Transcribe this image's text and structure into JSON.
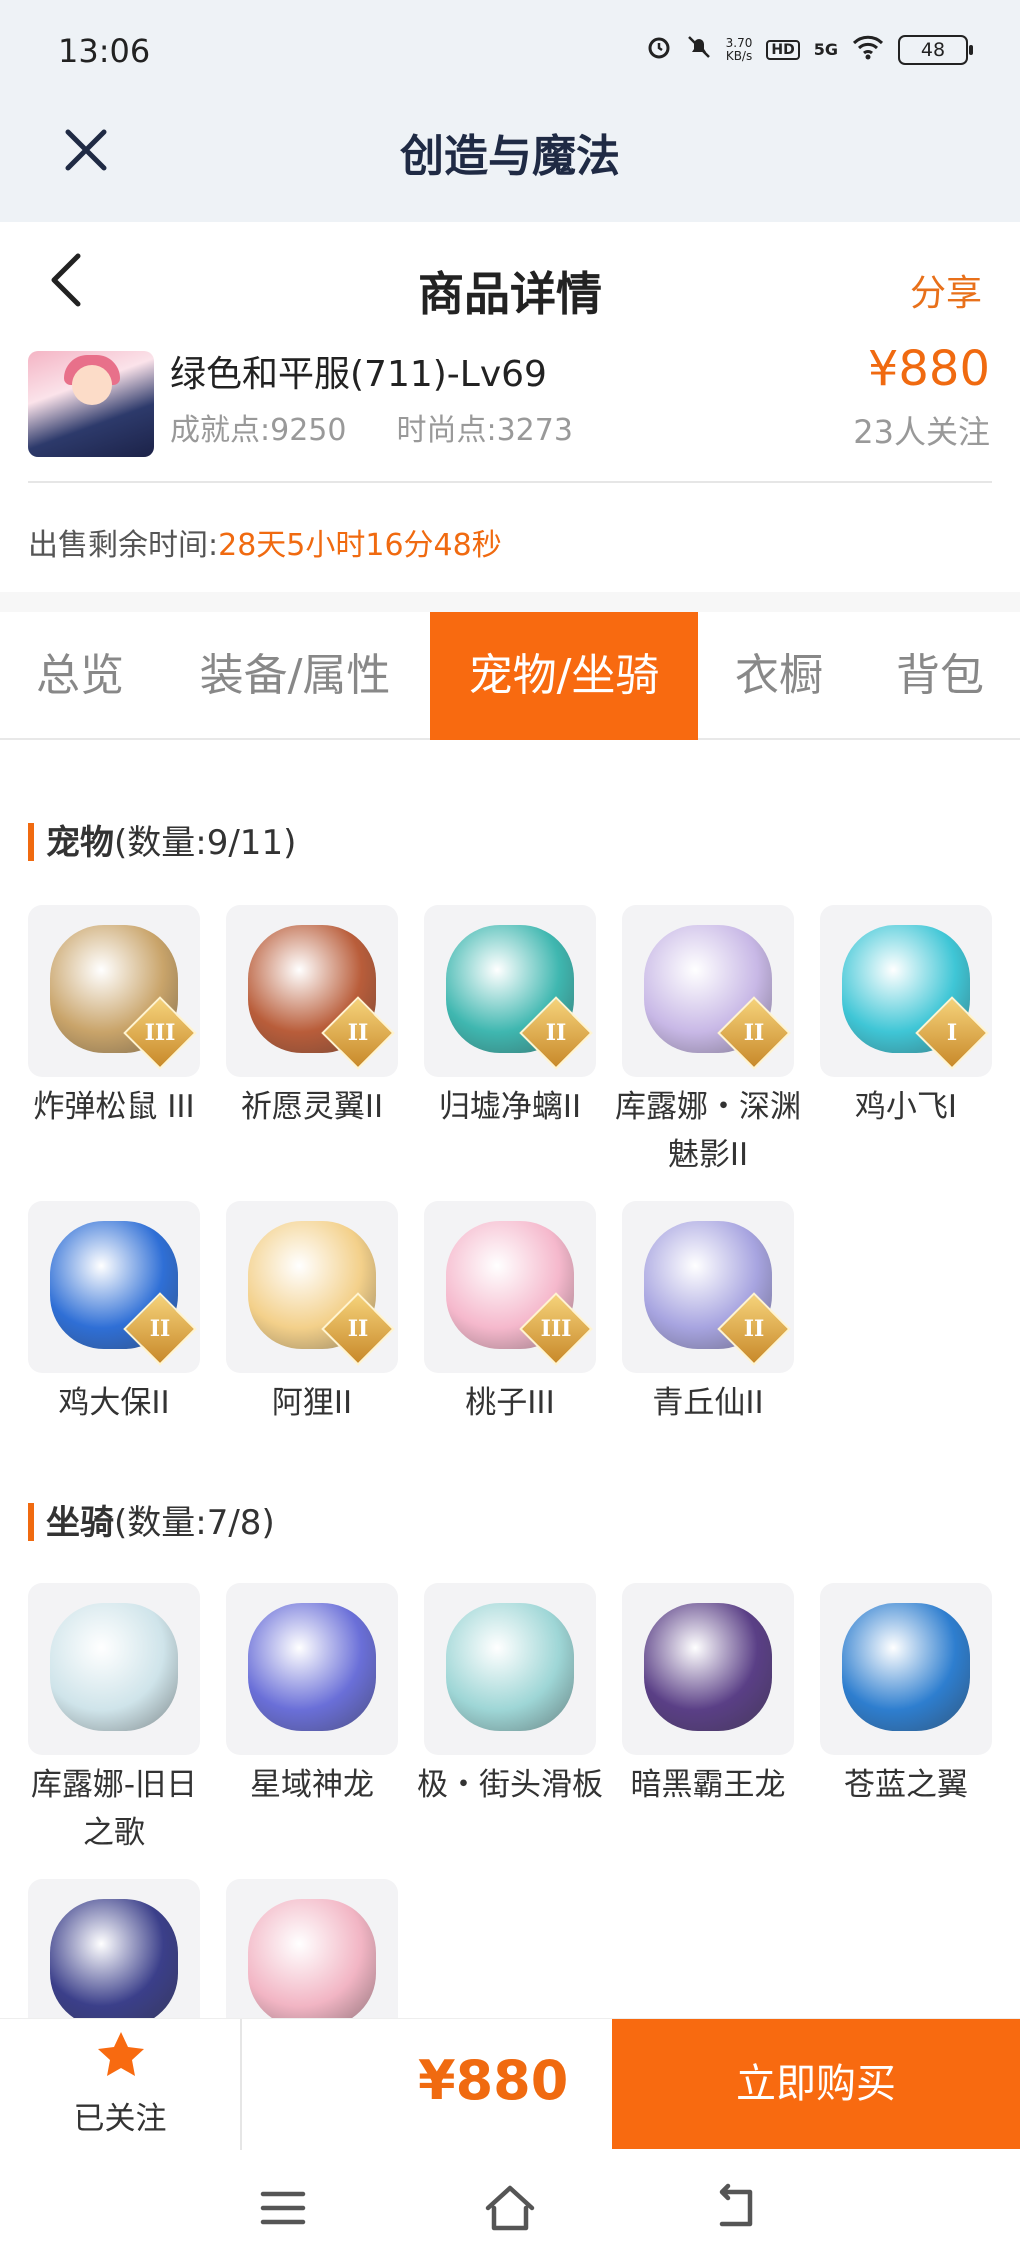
{
  "status_bar": {
    "time": "13:06",
    "net_speed_value": "3.70",
    "net_speed_unit": "KB/s",
    "hd_badge": "HD",
    "signal_label": "5G",
    "battery": "48",
    "icons": [
      "alarm-icon",
      "mute-icon",
      "wifi-icon",
      "battery-icon"
    ]
  },
  "app_bar": {
    "title": "创造与魔法",
    "close_icon": "close-icon"
  },
  "header": {
    "title": "商品详情",
    "share_label": "分享",
    "back_icon": "chevron-left-icon"
  },
  "product": {
    "name": "绿色和平服(711)-Lv69",
    "achievement": "成就点:9250",
    "fashion": "时尚点:3273",
    "price": "¥880",
    "followers": "23人关注"
  },
  "sale": {
    "label": "出售剩余时间:",
    "remaining": "28天5小时16分48秒"
  },
  "tabs": [
    {
      "label": "总览",
      "active": false
    },
    {
      "label": "装备/属性",
      "active": false
    },
    {
      "label": "宠物/坐骑",
      "active": true
    },
    {
      "label": "衣橱",
      "active": false
    },
    {
      "label": "背包",
      "active": false
    }
  ],
  "pets": {
    "title": "宠物",
    "count": "(数量:9/11)",
    "items": [
      {
        "name": "炸弹松鼠 III",
        "grade": "III",
        "color": "#c9a46a"
      },
      {
        "name": "祈愿灵翼II",
        "grade": "II",
        "color": "#b95d3a"
      },
      {
        "name": "归墟净螭II",
        "grade": "II",
        "color": "#3fb7b0"
      },
      {
        "name": "库露娜・深渊魅影II",
        "grade": "II",
        "color": "#c8b8e6"
      },
      {
        "name": "鸡小飞I",
        "grade": "I",
        "color": "#3fc6d6"
      },
      {
        "name": "鸡大保II",
        "grade": "II",
        "color": "#2f6fd6"
      },
      {
        "name": "阿狸II",
        "grade": "II",
        "color": "#f3d08a"
      },
      {
        "name": "桃子III",
        "grade": "III",
        "color": "#f5b8cc"
      },
      {
        "name": "青丘仙II",
        "grade": "II",
        "color": "#a7a4e0"
      }
    ]
  },
  "mounts": {
    "title": "坐骑",
    "count": "(数量:7/8)",
    "items": [
      {
        "name": "库露娜-旧日之歌",
        "color": "#cfe4ea"
      },
      {
        "name": "星域神龙",
        "color": "#6a6fd8"
      },
      {
        "name": "极・街头滑板",
        "color": "#9ed6d6"
      },
      {
        "name": "暗黑霸王龙",
        "color": "#5a3f86"
      },
      {
        "name": "苍蓝之翼",
        "color": "#2e7ecf"
      },
      {
        "name": "",
        "color": "#3b3f8a"
      },
      {
        "name": "",
        "color": "#f2b5c4"
      }
    ]
  },
  "bottom_bar": {
    "follow_label": "已关注",
    "price": "¥880",
    "buy_label": "立即购买"
  },
  "nav": {
    "icons": [
      "menu-icon",
      "home-icon",
      "back-icon"
    ]
  },
  "colors": {
    "accent": "#f86a10",
    "price": "#f06a10",
    "app_bar_bg": "#eef2f6"
  }
}
